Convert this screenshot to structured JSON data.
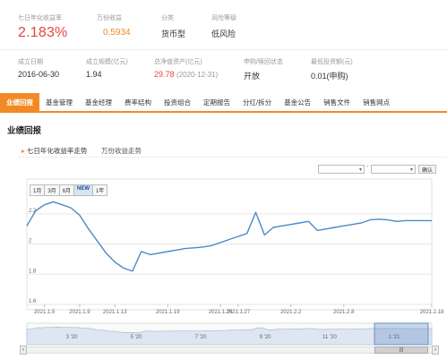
{
  "summary": {
    "row1": [
      {
        "label": "七日年化收益率",
        "value": "2.183%"
      },
      {
        "label": "万份收益",
        "value": "0.5934"
      },
      {
        "label": "分类",
        "value": "货币型"
      },
      {
        "label": "风险等级",
        "value": "低风险"
      }
    ],
    "row2": [
      {
        "label": "成立日期",
        "value": "2016-06-30"
      },
      {
        "label": "成立规模(亿元)",
        "value": "1.94"
      },
      {
        "label": "总净值资产(亿元)",
        "value": "29.78",
        "note": "(2020-12-31)"
      },
      {
        "label": "申购/赎回状态",
        "value": "开放"
      },
      {
        "label": "最低投资额(元)",
        "value": "0.01(申购)"
      }
    ]
  },
  "tabs": [
    "业绩回报",
    "基金管理",
    "基金经理",
    "费率结构",
    "投资组合",
    "定期报告",
    "分红/拆分",
    "基金公告",
    "销售文件",
    "销售网点"
  ],
  "section_title": "业绩回报",
  "subtabs": [
    "七日年化收益率走势",
    "万份收益走势"
  ],
  "controls": {
    "confirm_label": "确认",
    "range_buttons": [
      "1月",
      "3月",
      "6月",
      "NEW",
      "1年"
    ],
    "selected_range": "NEW"
  },
  "navigator_labels": [
    "3 '20",
    "5 '20",
    "7 '20",
    "9 '20",
    "11 '20",
    "1 '21"
  ],
  "colors": {
    "accent": "#f08a24",
    "red": "#e64340",
    "line": "#4a8ac7"
  },
  "chart_data": {
    "type": "line",
    "title": "",
    "xlabel": "",
    "ylabel": "",
    "x": [
      "2021.1.3",
      "2021.1.4",
      "2021.1.5",
      "2021.1.6",
      "2021.1.7",
      "2021.1.8",
      "2021.1.9",
      "2021.1.10",
      "2021.1.11",
      "2021.1.12",
      "2021.1.13",
      "2021.1.14",
      "2021.1.15",
      "2021.1.16",
      "2021.1.17",
      "2021.1.18",
      "2021.1.19",
      "2021.1.20",
      "2021.1.21",
      "2021.1.22",
      "2021.1.23",
      "2021.1.24",
      "2021.1.25",
      "2021.1.26",
      "2021.1.27",
      "2021.1.28",
      "2021.1.29",
      "2021.1.30",
      "2021.1.31",
      "2021.2.1",
      "2021.2.2",
      "2021.2.3",
      "2021.2.4",
      "2021.2.5",
      "2021.2.6",
      "2021.2.7",
      "2021.2.8",
      "2021.2.9",
      "2021.2.10",
      "2021.2.11",
      "2021.2.12",
      "2021.2.13",
      "2021.2.14",
      "2021.2.15",
      "2021.2.16",
      "2021.2.17",
      "2021.2.18"
    ],
    "values": [
      2.12,
      2.22,
      2.26,
      2.28,
      2.26,
      2.24,
      2.19,
      2.1,
      2.02,
      1.94,
      1.88,
      1.84,
      1.82,
      1.95,
      1.93,
      1.94,
      1.95,
      1.96,
      1.97,
      1.975,
      1.98,
      1.99,
      2.01,
      2.03,
      2.05,
      2.07,
      2.21,
      2.06,
      2.11,
      2.12,
      2.13,
      2.14,
      2.15,
      2.09,
      2.1,
      2.11,
      2.12,
      2.13,
      2.14,
      2.16,
      2.165,
      2.16,
      2.15,
      2.155,
      2.155,
      2.155,
      2.155
    ],
    "ylim": [
      1.6,
      2.3
    ],
    "yticks": [
      "2.2",
      "2",
      "1.8",
      "1.6"
    ],
    "xtick_labels": [
      "2021.1.5",
      "2021.1.9",
      "2021.1.13",
      "2021.1.19",
      "2021.1.25",
      "2021.1.27",
      "2021.2.2",
      "2021.2.8",
      "2021.2.18"
    ],
    "grid": true,
    "legend": "none"
  }
}
